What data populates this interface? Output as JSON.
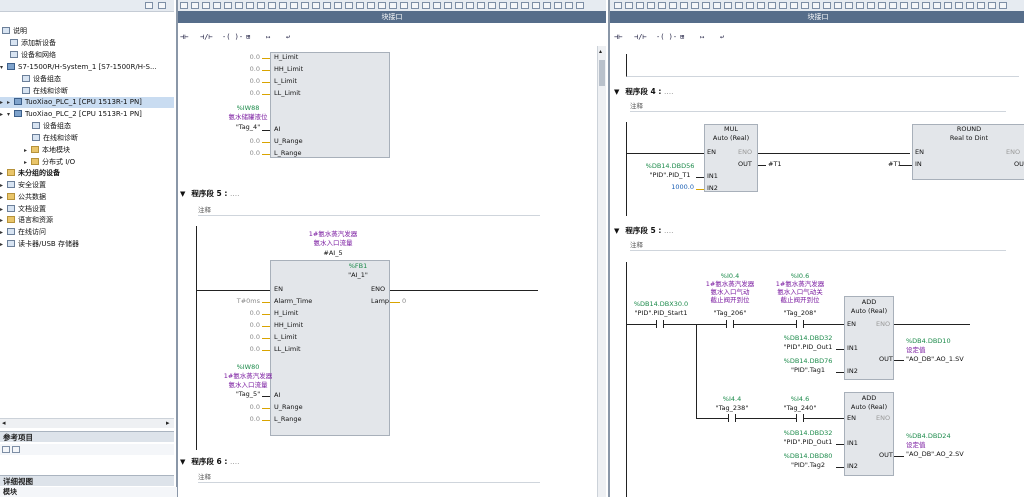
{
  "tree": {
    "items": [
      {
        "label": "说明"
      },
      {
        "label": "添加新设备"
      },
      {
        "label": "设备和网络"
      },
      {
        "label": "S7-1500R/H-System_1 [S7-1500R/H-S..."
      },
      {
        "label": "设备组态"
      },
      {
        "label": "在线和诊断"
      },
      {
        "label": "TuoXiao_PLC_1 [CPU 1513R-1 PN]"
      },
      {
        "label": "TuoXiao_PLC_2 [CPU 1513R-1 PN]"
      },
      {
        "label": "设备组态"
      },
      {
        "label": "在线和诊断"
      },
      {
        "label": "本地模块"
      },
      {
        "label": "分布式 I/O"
      },
      {
        "label": "未分组的设备"
      },
      {
        "label": "安全设置"
      },
      {
        "label": "公共数据"
      },
      {
        "label": "文档设置"
      },
      {
        "label": "语言和资源"
      },
      {
        "label": "在线访问"
      },
      {
        "label": "读卡器/USB 存储器"
      }
    ],
    "reference_title": "参考项目",
    "detail_title": "详细视图",
    "detail_sub": "模块"
  },
  "left_editor": {
    "title": "块接口",
    "ladder_buttons": [
      "⊣⊢",
      "⊣/⊢",
      "-( )-",
      "⊞",
      "↦",
      "↩"
    ],
    "upper_pins": [
      "H_Limit",
      "HH_Limit",
      "L_Limit",
      "LL_Limit"
    ],
    "upper_vals": [
      "0.0",
      "0.0",
      "0.0",
      "0.0"
    ],
    "upper_input": {
      "addr": "%IW88",
      "comment": "氨水储罐液位",
      "tag": "\"Tag_4\"",
      "pin": "AI"
    },
    "upper_pins2": [
      "U_Range",
      "L_Range"
    ],
    "upper_vals2": [
      "0.0",
      "0.0"
    ],
    "seg5": {
      "title": "程序段 5 :",
      "dots": "....",
      "comment": "注释"
    },
    "fb": {
      "comment_line1": "1#氨水蒸汽发器",
      "comment_line2": "氨水入口流量",
      "instance_hash": "#AI_5",
      "instance_addr": "%FB1",
      "name": "\"AI_1\"",
      "en": "EN",
      "eno": "ENO",
      "pins": [
        "Alarm_Time",
        "H_Limit",
        "HH_Limit",
        "L_Limit",
        "LL_Limit"
      ],
      "pin_vals": [
        "T#0ms",
        "0.0",
        "0.0",
        "0.0",
        "0.0"
      ],
      "out_pin": "Lamp",
      "out_val": "0",
      "in_addr": "%IW80",
      "in_comment1": "1#氨水蒸汽发器",
      "in_comment2": "氨水入口流量",
      "in_tag": "\"Tag_5\"",
      "in_pin": "AI",
      "pins2": [
        "U_Range",
        "L_Range"
      ],
      "pins2_vals": [
        "0.0",
        "0.0"
      ]
    },
    "seg6": {
      "title": "程序段 6 :",
      "dots": "....",
      "comment": "注释"
    }
  },
  "right_editor": {
    "title": "块接口",
    "ladder_buttons": [
      "⊣⊢",
      "⊣/⊢",
      "-( )-",
      "⊞",
      "↦",
      "↩"
    ],
    "seg4": {
      "title": "程序段 4 :",
      "dots": "....",
      "comment": "注释"
    },
    "mul": {
      "name": "MUL",
      "type": "Auto (Real)",
      "en": "EN",
      "eno": "ENO",
      "out": "OUT",
      "out_tag": "#T1",
      "in1_addr": "%DB14.DBD56",
      "in1_tag": "\"PID\".PID_T1",
      "in1": "IN1",
      "in2": "IN2",
      "in2_val": "1000.0"
    },
    "round": {
      "name": "ROUND",
      "type": "Real to Dint",
      "en": "EN",
      "eno": "ENO",
      "in": "IN",
      "out": "OU",
      "in_tag": "#T1"
    },
    "seg5": {
      "title": "程序段 5 :",
      "dots": "....",
      "comment": "注释"
    },
    "rung1": {
      "c1_addr": "%DB14.DBX30.0",
      "c1_tag": "\"PID\".PID_Start1",
      "c2_addr": "%I0.4",
      "c2_c1": "1#氨水蒸汽发器",
      "c2_c2": "氨水入口气动",
      "c2_c3": "截止阀开到位",
      "c2_tag": "\"Tag_206\"",
      "c3_addr": "%I0.6",
      "c3_c1": "1#氨水蒸汽发器",
      "c3_c2": "氨水入口气动关",
      "c3_c3": "截止阀开到位",
      "c3_tag": "\"Tag_208\"",
      "add": {
        "name": "ADD",
        "type": "Auto (Real)",
        "en": "EN",
        "eno": "ENO",
        "in1": "IN1",
        "in2": "IN2",
        "out": "OUT",
        "in1_addr": "%DB14.DBD32",
        "in1_tag": "\"PID\".PID_Out1",
        "in2_addr": "%DB14.DBD76",
        "in2_tag": "\"PID\".Tag1",
        "out_addr": "%DB4.DBD10",
        "out_comment": "设定值",
        "out_tag": "\"AO_DB\".AO_1.SV"
      }
    },
    "rung2": {
      "c1_addr": "%I4.4",
      "c1_tag": "\"Tag_238\"",
      "c2_addr": "%I4.6",
      "c2_tag": "\"Tag_240\"",
      "add": {
        "name": "ADD",
        "type": "Auto (Real)",
        "en": "EN",
        "eno": "ENO",
        "in1": "IN1",
        "in2": "IN2",
        "out": "OUT",
        "in1_addr": "%DB14.DBD32",
        "in1_tag": "\"PID\".PID_Out1",
        "in2_addr": "%DB14.DBD80",
        "in2_tag": "\"PID\".Tag2",
        "out_addr": "%DB4.DBD24",
        "out_comment": "设定值",
        "out_tag": "\"AO_DB\".AO_2.SV"
      }
    }
  },
  "colors": {
    "title_bar": "#566d8a",
    "green_addr": "#1b8a4a",
    "purple_comment": "#7a1aa0",
    "block_fill": "#e3e6ea"
  }
}
